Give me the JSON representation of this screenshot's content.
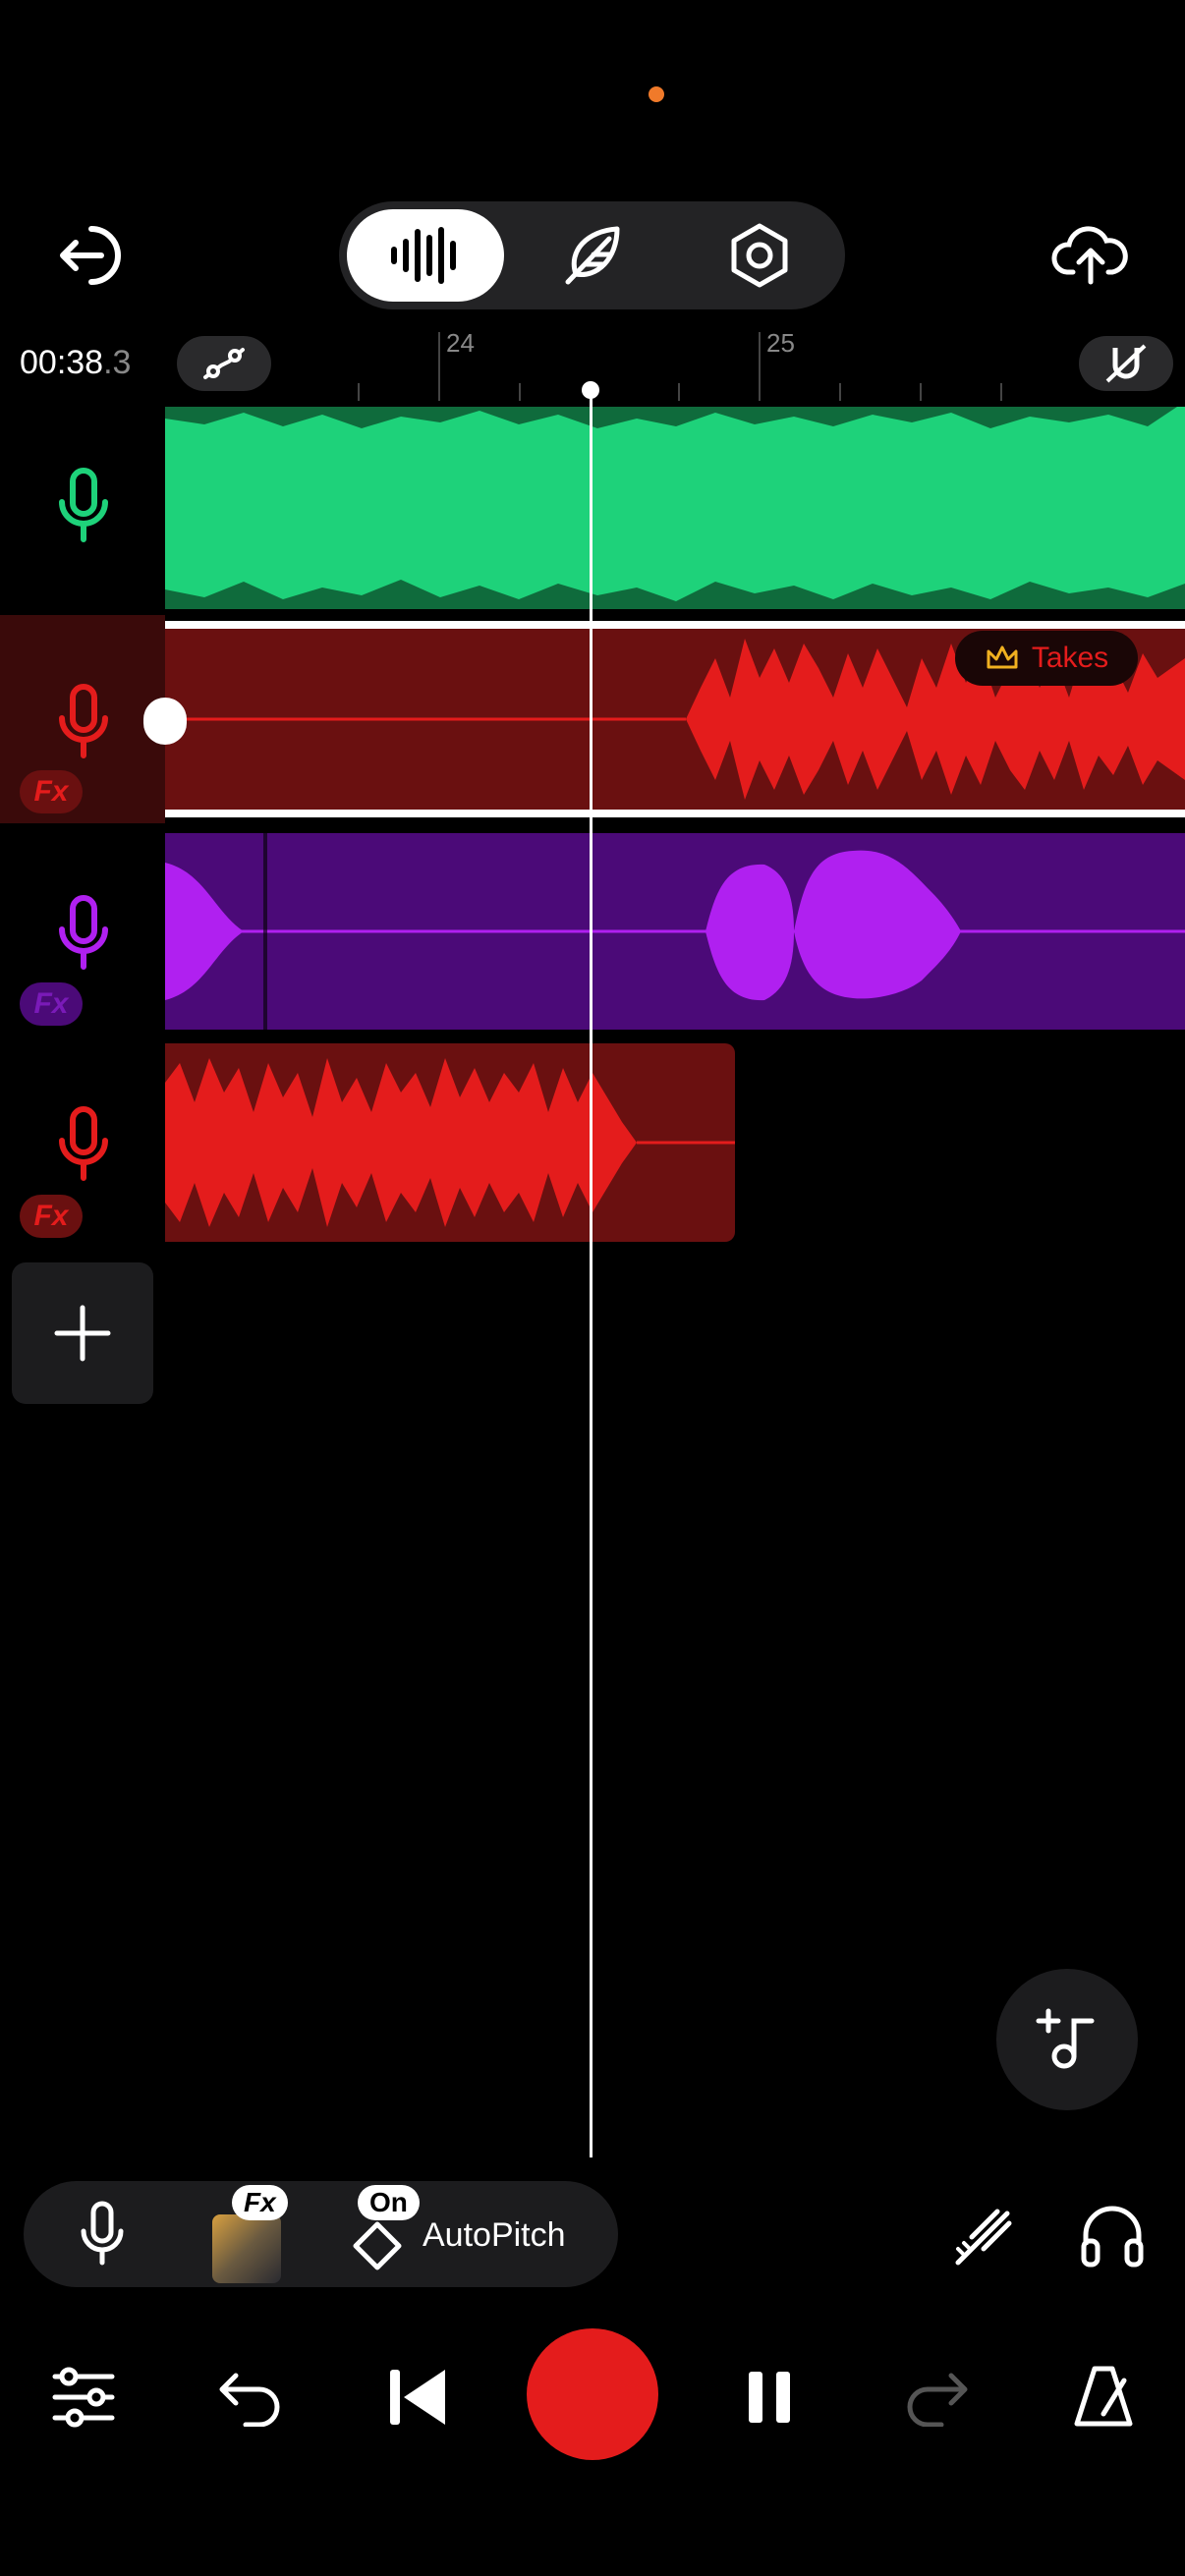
{
  "header": {
    "time_main": "00:38",
    "time_frac": ".3",
    "ruler_labels": [
      "24",
      "25"
    ],
    "tabs": [
      {
        "icon": "waveform-icon",
        "active": true
      },
      {
        "icon": "feather-icon",
        "active": false
      },
      {
        "icon": "hexagon-settings-icon",
        "active": false
      }
    ]
  },
  "tracks": [
    {
      "name": "track-1",
      "color": "#1ed27a",
      "dark": "#0f6b3c",
      "fx": false
    },
    {
      "name": "track-2",
      "color": "#e41c1c",
      "dark": "#6a1010",
      "fx": true,
      "fx_label": "Fx",
      "takes_label": "Takes"
    },
    {
      "name": "track-3",
      "color": "#b020f0",
      "dark": "#4b0a78",
      "fx": true,
      "fx_label": "Fx"
    },
    {
      "name": "track-4",
      "color": "#e41c1c",
      "dark": "#6a1010",
      "fx": true,
      "fx_label": "Fx"
    }
  ],
  "bottom": {
    "fx_badge": "Fx",
    "on_badge": "On",
    "autopitch_label": "AutoPitch"
  },
  "colors": {
    "record": "#e41c1c",
    "accent_orange": "#f07a2a"
  }
}
